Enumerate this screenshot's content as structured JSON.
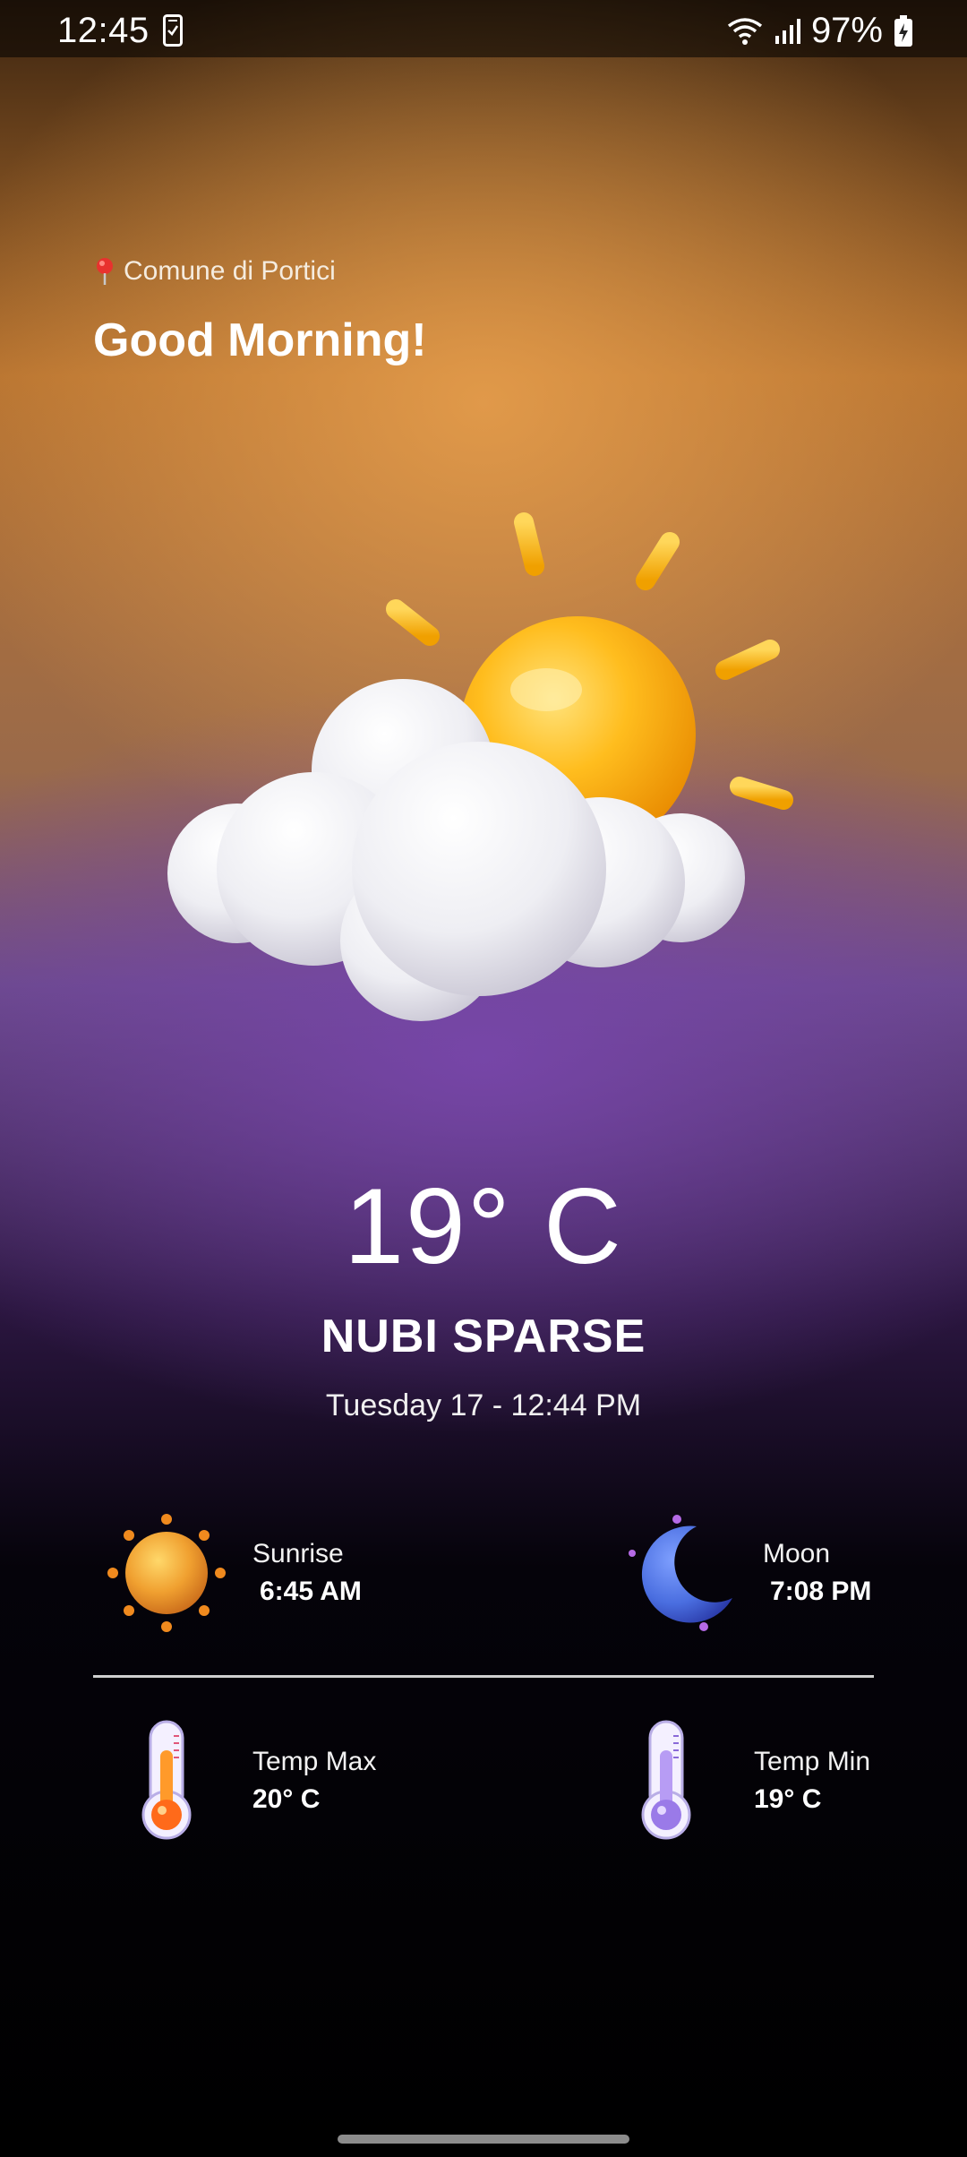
{
  "status_bar": {
    "time": "12:45",
    "battery": "97%",
    "icons": [
      "phone-checklist-icon",
      "wifi-icon",
      "signal-icon",
      "battery-charging-icon"
    ]
  },
  "location": {
    "icon": "location-pin-icon",
    "name": "Comune di Portici"
  },
  "greeting": "Good Morning!",
  "weather": {
    "icon": "partly-cloudy-icon",
    "temperature": "19° C",
    "condition": "NUBI SPARSE",
    "datetime": "Tuesday 17 - 12:44 PM"
  },
  "details": {
    "sunrise": {
      "label": "Sunrise",
      "value": "6:45 AM",
      "icon": "sun-icon"
    },
    "moon": {
      "label": "Moon",
      "value": "7:08 PM",
      "icon": "moon-icon"
    },
    "temp_max": {
      "label": "Temp Max",
      "value": "20° C",
      "icon": "thermometer-hot-icon"
    },
    "temp_min": {
      "label": "Temp Min",
      "value": "19° C",
      "icon": "thermometer-cold-icon"
    }
  },
  "colors": {
    "sun": "#ffb21a",
    "sky_top": "#b6722f",
    "sky_mid": "#6a4a8a",
    "background_bottom": "#000000",
    "moon": "#4a6ee0",
    "thermo_hot": "#ff7a1a",
    "thermo_cold": "#a98bf0"
  }
}
